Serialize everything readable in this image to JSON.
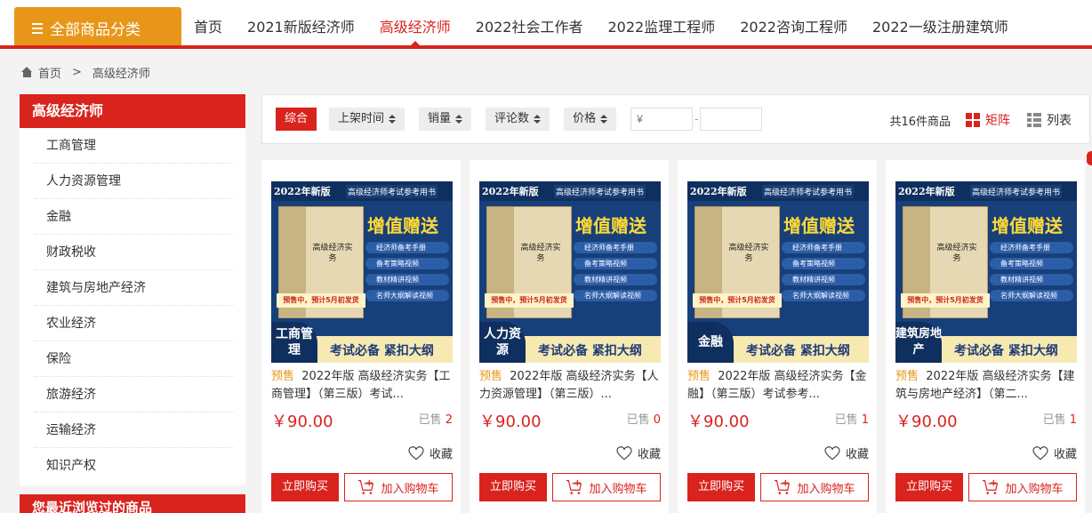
{
  "nav": {
    "all_categories": "全部商品分类",
    "items": [
      "首页",
      "2021新版经济师",
      "高级经济师",
      "2022社会工作者",
      "2022监理工程师",
      "2022咨询工程师",
      "2022一级注册建筑师"
    ],
    "active_index": 2
  },
  "breadcrumb": {
    "home": "首页",
    "sep": ">",
    "current": "高级经济师"
  },
  "sidebar": {
    "title": "高级经济师",
    "items": [
      "工商管理",
      "人力资源管理",
      "金融",
      "财政税收",
      "建筑与房地产经济",
      "农业经济",
      "保险",
      "旅游经济",
      "运输经济",
      "知识产权"
    ],
    "recent_title": "您最近浏览过的商品"
  },
  "toolbar": {
    "sorts": [
      "综合",
      "上架时间",
      "销量",
      "评论数",
      "价格"
    ],
    "price_min_placeholder": "¥",
    "price_max_placeholder": "",
    "price_sep": "-",
    "total": "共16件商品",
    "view_grid": "矩阵",
    "view_list": "列表"
  },
  "cover": {
    "year": "2022年新版",
    "ref": "高级经济师考试参考用书",
    "book_title": "高级经济实务",
    "bonus": "增值赠送",
    "features": [
      "经济师备考手册",
      "备考策略视频",
      "教材精讲视频",
      "名师大纲解读视频"
    ],
    "presale_note": "预售中，预计5月初发货",
    "slogan": "考试必备 紧扣大纲"
  },
  "products": [
    {
      "badge": "工商管理",
      "presale": "预售",
      "title": "2022年版 高级经济实务【工商管理】（第三版）考试...",
      "price": "￥90.00",
      "sold_label": "已售",
      "sold": "2",
      "fav": "收藏",
      "buy": "立即购买",
      "cart": "加入购物车"
    },
    {
      "badge": "人力资源",
      "presale": "预售",
      "title": "2022年版 高级经济实务【人力资源管理】（第三版）...",
      "price": "￥90.00",
      "sold_label": "已售",
      "sold": "0",
      "fav": "收藏",
      "buy": "立即购买",
      "cart": "加入购物车"
    },
    {
      "badge": "金融",
      "presale": "预售",
      "title": "2022年版 高级经济实务【金融】（第三版）考试参考...",
      "price": "￥90.00",
      "sold_label": "已售",
      "sold": "1",
      "fav": "收藏",
      "buy": "立即购买",
      "cart": "加入购物车"
    },
    {
      "badge": "建筑房地产",
      "presale": "预售",
      "title": "2022年版 高级经济实务【建筑与房地产经济】（第二...",
      "price": "￥90.00",
      "sold_label": "已售",
      "sold": "1",
      "fav": "收藏",
      "buy": "立即购买",
      "cart": "加入购物车"
    }
  ],
  "colors": {
    "brand_red": "#d9231d",
    "category_orange": "#e8961a"
  }
}
